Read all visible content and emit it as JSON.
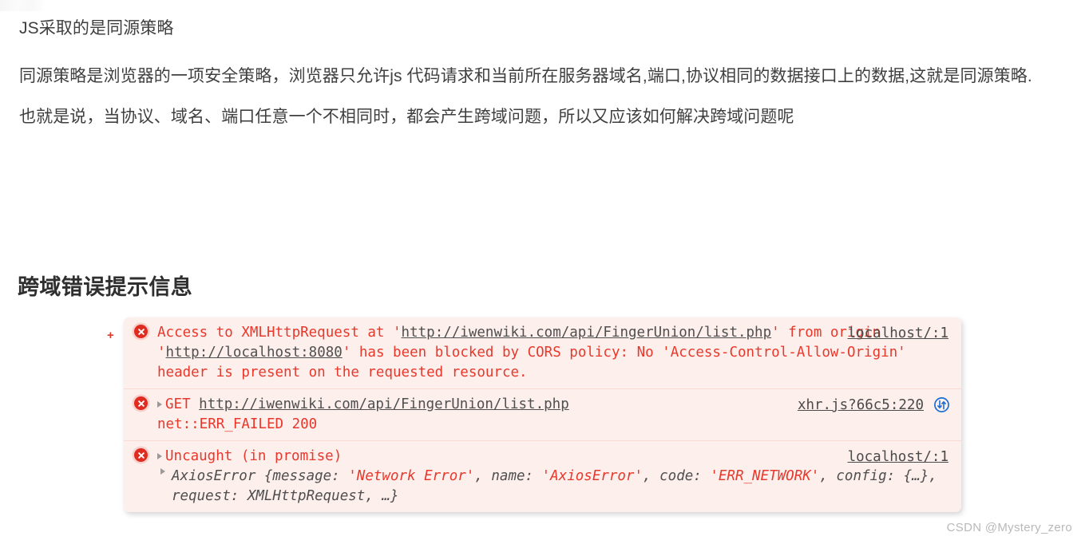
{
  "article": {
    "lead": "JS采取的是同源策略",
    "paragraph_1": "同源策略是浏览器的一项安全策略，浏览器只允许js 代码请求和当前所在服务器域名,端口,协议相同的数据接口上的数据,这就是同源策略.",
    "paragraph_2": "也就是说，当协议、域名、端口任意一个不相同时，都会产生跨域问题，所以又应该如何解决跨域问题呢",
    "section_heading": "跨域错误提示信息"
  },
  "console": {
    "expand_marker": "+",
    "error_icon_name": "error-circle-icon",
    "rows": [
      {
        "id": "cors-error",
        "text_1": "Access to XMLHttpRequest at '",
        "url_1": "http://iwenwiki.com/api/FingerUnion/list.php",
        "text_2": "' from origin '",
        "url_2": "http://localhost:8080",
        "text_3": "' has been blocked by CORS policy: No 'Access-Control-Allow-Origin' header is present on the requested resource.",
        "source": "localhost/:1",
        "badge": false
      },
      {
        "id": "net-err-failed",
        "method": "GET",
        "url": "http://iwenwiki.com/api/FingerUnion/list.php",
        "status_text": "net::ERR_FAILED 200",
        "source": "xhr.js?66c5:220",
        "badge": true,
        "badge_name": "network-request-icon"
      },
      {
        "id": "uncaught-promise",
        "title": "Uncaught (in promise)",
        "object_name": "AxiosError",
        "object_body": " {message: 'Network Error', name: 'AxiosError', code: 'ERR_NETWORK', config: {…}, request: XMLHttpRequest, …}",
        "obj_parts": [
          {
            "t": "AxiosError {message: ",
            "c": "grey"
          },
          {
            "t": "'Network Error'",
            "c": "red"
          },
          {
            "t": ", name: ",
            "c": "grey"
          },
          {
            "t": "'AxiosError'",
            "c": "red"
          },
          {
            "t": ", code: ",
            "c": "grey"
          },
          {
            "t": "'ERR_NETWORK'",
            "c": "red"
          },
          {
            "t": ", config: {…}, request: XMLHttpRequest, …}",
            "c": "grey"
          }
        ],
        "source": "localhost/:1",
        "badge": false
      }
    ]
  },
  "watermark": "CSDN @Mystery_zero",
  "colors": {
    "console_bg": "#fdefec",
    "error_red": "#e8382c",
    "error_icon": "#df2b20",
    "link_grey": "#4a4a4a",
    "badge_blue": "#1a6fd4",
    "page_text": "#3f3f3f"
  }
}
